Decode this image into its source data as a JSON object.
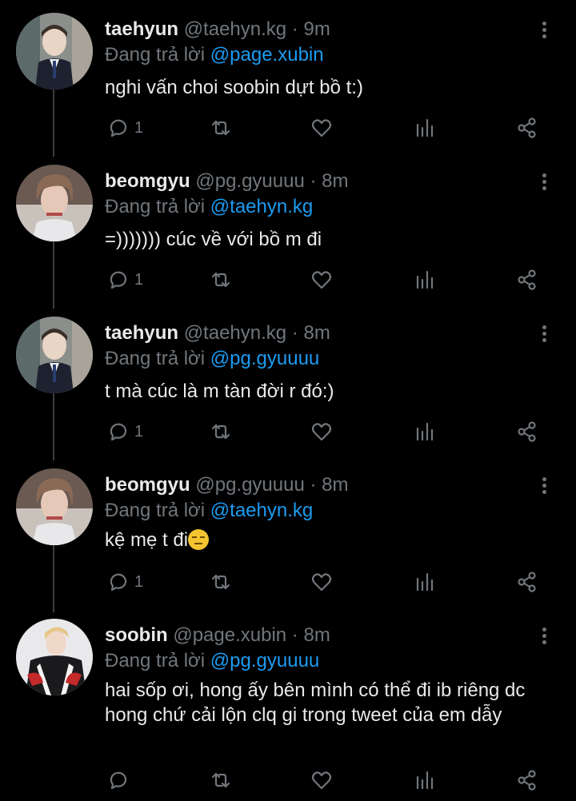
{
  "tweets": [
    {
      "name": "taehyun",
      "handle": "@taehyn.kg",
      "separator": "·",
      "time": "9m",
      "reply_prefix": "Đang trả lời",
      "reply_to": "@page.xubin",
      "text": "nghi vấn choi soobin dựt bồ t:)",
      "reply_count": "1",
      "avatar": "avatar-taehyun"
    },
    {
      "name": "beomgyu",
      "handle": "@pg.gyuuuu",
      "separator": "·",
      "time": "8m",
      "reply_prefix": "Đang trả lời",
      "reply_to": "@taehyn.kg",
      "text": "=))))))) cúc về với bồ m đi",
      "reply_count": "1",
      "avatar": "avatar-beomgyu"
    },
    {
      "name": "taehyun",
      "handle": "@taehyn.kg",
      "separator": "·",
      "time": "8m",
      "reply_prefix": "Đang trả lời",
      "reply_to": "@pg.gyuuuu",
      "text": "t mà cúc là m tàn đời r đó:)",
      "reply_count": "1",
      "avatar": "avatar-taehyun"
    },
    {
      "name": "beomgyu",
      "handle": "@pg.gyuuuu",
      "separator": "·",
      "time": "8m",
      "reply_prefix": "Đang trả lời",
      "reply_to": "@taehyn.kg",
      "text": "kệ mẹ t đi",
      "emoji": "expressionless-face",
      "reply_count": "1",
      "avatar": "avatar-beomgyu"
    },
    {
      "name": "soobin",
      "handle": "@page.xubin",
      "separator": "·",
      "time": "8m",
      "reply_prefix": "Đang trả lời",
      "reply_to": "@pg.gyuuuu",
      "text": "hai sốp ơi, hong ấy bên mình có thể đi ib riêng dc hong chứ cải lộn clq gi trong tweet của em dẫy",
      "reply_count": "",
      "avatar": "avatar-soobin"
    }
  ],
  "icons": {
    "reply": "reply-bubble-icon",
    "retweet": "retweet-icon",
    "like": "heart-icon",
    "analytics": "analytics-bars-icon",
    "share": "share-icon",
    "more": "more-vertical-icon"
  },
  "colors": {
    "background": "#000000",
    "text": "#e7e9ea",
    "muted": "#71767b",
    "mention": "#1d9bf0"
  }
}
